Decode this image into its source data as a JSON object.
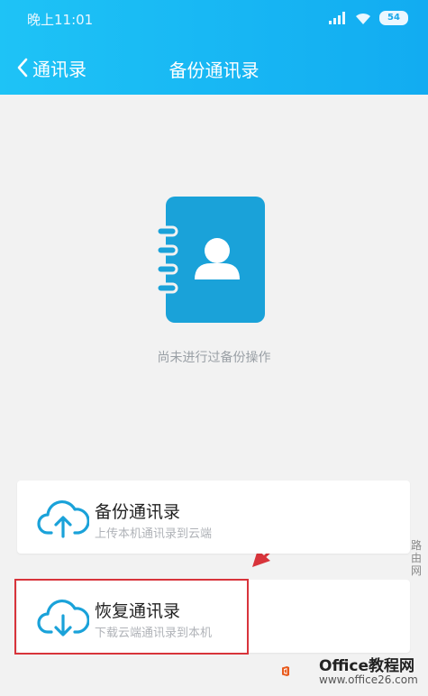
{
  "status": {
    "time": "晚上11:01",
    "battery": "54"
  },
  "nav": {
    "back_label": "通讯录",
    "title": "备份通讯录"
  },
  "empty_state": {
    "text": "尚未进行过备份操作"
  },
  "cards": [
    {
      "title": "备份通讯录",
      "subtitle": "上传本机通讯录到云端",
      "icon": "cloud-upload-icon"
    },
    {
      "title": "恢复通讯录",
      "subtitle": "下载云端通讯录到本机",
      "icon": "cloud-download-icon"
    }
  ],
  "watermark": {
    "side_text": "路由网",
    "brand": "Office教程网",
    "url": "www.office26.com"
  },
  "colors": {
    "header": "#12acf1",
    "accent": "#1aa2d9",
    "highlight": "#d8343b"
  }
}
